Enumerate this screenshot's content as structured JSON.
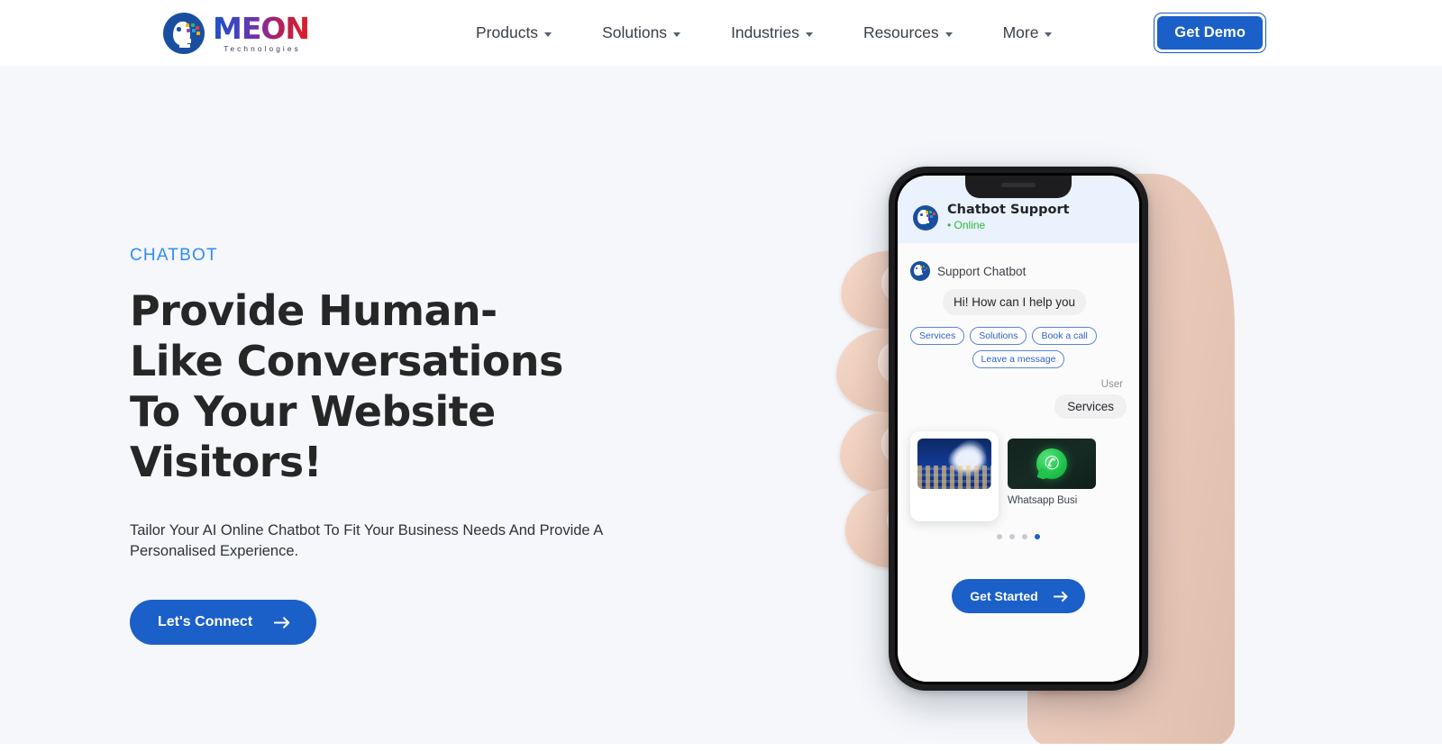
{
  "header": {
    "logo": {
      "word": "MEON",
      "sub": "Technologies",
      "icon": "meon-head-logo-icon"
    },
    "nav": [
      {
        "label": "Products",
        "caret": "chevron-down-icon"
      },
      {
        "label": "Solutions",
        "caret": "chevron-down-icon"
      },
      {
        "label": "Industries",
        "caret": "chevron-down-icon"
      },
      {
        "label": "Resources",
        "caret": "chevron-down-icon"
      },
      {
        "label": "More",
        "caret": "chevron-down-icon"
      }
    ],
    "cta": {
      "label": "Get Demo"
    }
  },
  "hero": {
    "eyebrow": "CHATBOT",
    "title": "Provide Human-Like Conversations To Your Website Visitors!",
    "subtitle": "Tailor Your AI Online Chatbot To Fit Your Business Needs And Provide A Personalised Experience.",
    "cta": {
      "label": "Let's Connect",
      "icon": "arrow-right-icon"
    }
  },
  "phone": {
    "chat_header": {
      "title": "Chatbot Support",
      "status": "• Online",
      "avatar": "chatbot-avatar-icon"
    },
    "bot_name": "Support Chatbot",
    "bot_message": "Hi! How can I help you",
    "quick_replies": [
      "Services",
      "Solutions",
      "Book a call",
      "Leave a message"
    ],
    "user_label": "User",
    "user_message": "Services",
    "cards": [
      {
        "caption": "",
        "image": "ai-brain-network-image"
      },
      {
        "caption": "Whatsapp Busi",
        "image": "whatsapp-logo-icon"
      }
    ],
    "carousel": {
      "total": 4,
      "active_index": 3
    },
    "cta": {
      "label": "Get Started",
      "icon": "arrow-right-icon"
    }
  },
  "colors": {
    "brand_blue": "#1b5fc8",
    "eyebrow_blue": "#2f8cf6",
    "hero_bg": "#f5f7fb",
    "header_bg": "#ffffff",
    "online_green": "#2eb83c",
    "heading_dark": "#262626"
  }
}
